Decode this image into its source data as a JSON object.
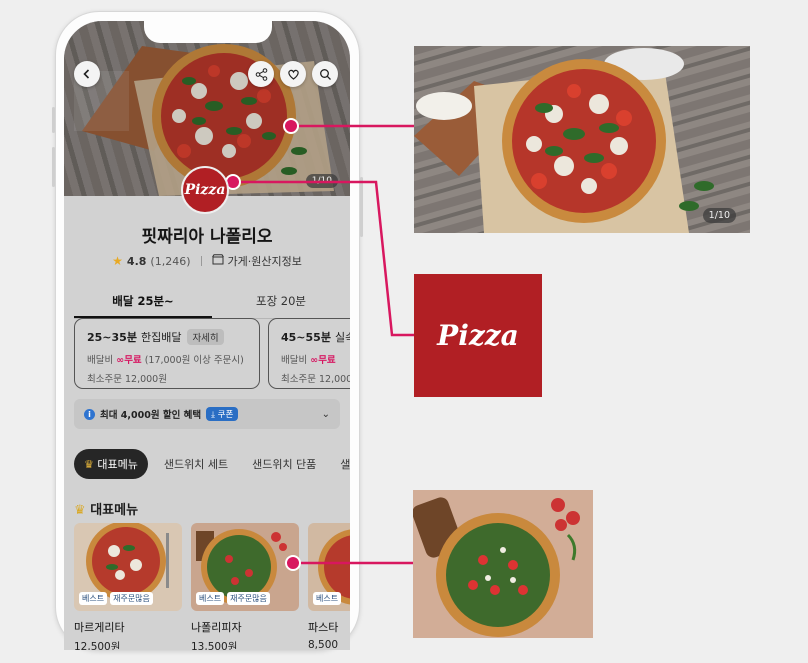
{
  "store": {
    "name": "핏짜리아 나폴리오",
    "rating": "4.8",
    "review_count": "(1,246)",
    "info_link": "가게·원산지정보",
    "logo_text": "Pizza"
  },
  "hero": {
    "photo_counter": "1/10"
  },
  "header_buttons": [
    "back",
    "share",
    "favorite",
    "search"
  ],
  "order_tabs": [
    {
      "label": "배달 25분~",
      "active": true
    },
    {
      "label": "포장 20분",
      "active": false
    }
  ],
  "delivery_options": [
    {
      "time": "25~35분",
      "type": "한집배달",
      "detail_btn": "자세히",
      "fee_label": "배달비",
      "fee_value": "무료",
      "fee_condition": "(17,000원 이상 주문시)",
      "min_order": "최소주문 12,000원"
    },
    {
      "time": "45~55분",
      "type": "실속배",
      "fee_label": "배달비",
      "fee_value": "무료",
      "min_order": "최소주문 12,000원"
    }
  ],
  "coupon_bar": {
    "text": "최대 4,000원 할인 혜택",
    "pill": "쿠폰"
  },
  "menu_tabs": [
    {
      "label": "대표메뉴",
      "active": true
    },
    {
      "label": "샌드위치 세트",
      "active": false
    },
    {
      "label": "샌드위치 단품",
      "active": false
    },
    {
      "label": "샐",
      "active": false
    }
  ],
  "section_title": "대표메뉴",
  "menu_items": [
    {
      "name": "마르게리타",
      "price": "12,500원",
      "badges": [
        "베스트",
        "재주문많음"
      ]
    },
    {
      "name": "나폴리피자",
      "price": "13,500원",
      "badges": [
        "베스트",
        "재주문많음"
      ]
    },
    {
      "name": "파스타",
      "price": "8,500",
      "badges": [
        "베스트"
      ]
    }
  ],
  "callouts": {
    "hero_counter": "1/10",
    "logo_text": "Pizza"
  },
  "colors": {
    "accent_line": "#d8175f",
    "logo_red": "#b11f24",
    "free_text": "#d61862",
    "coupon_blue": "#2a6ec4"
  }
}
